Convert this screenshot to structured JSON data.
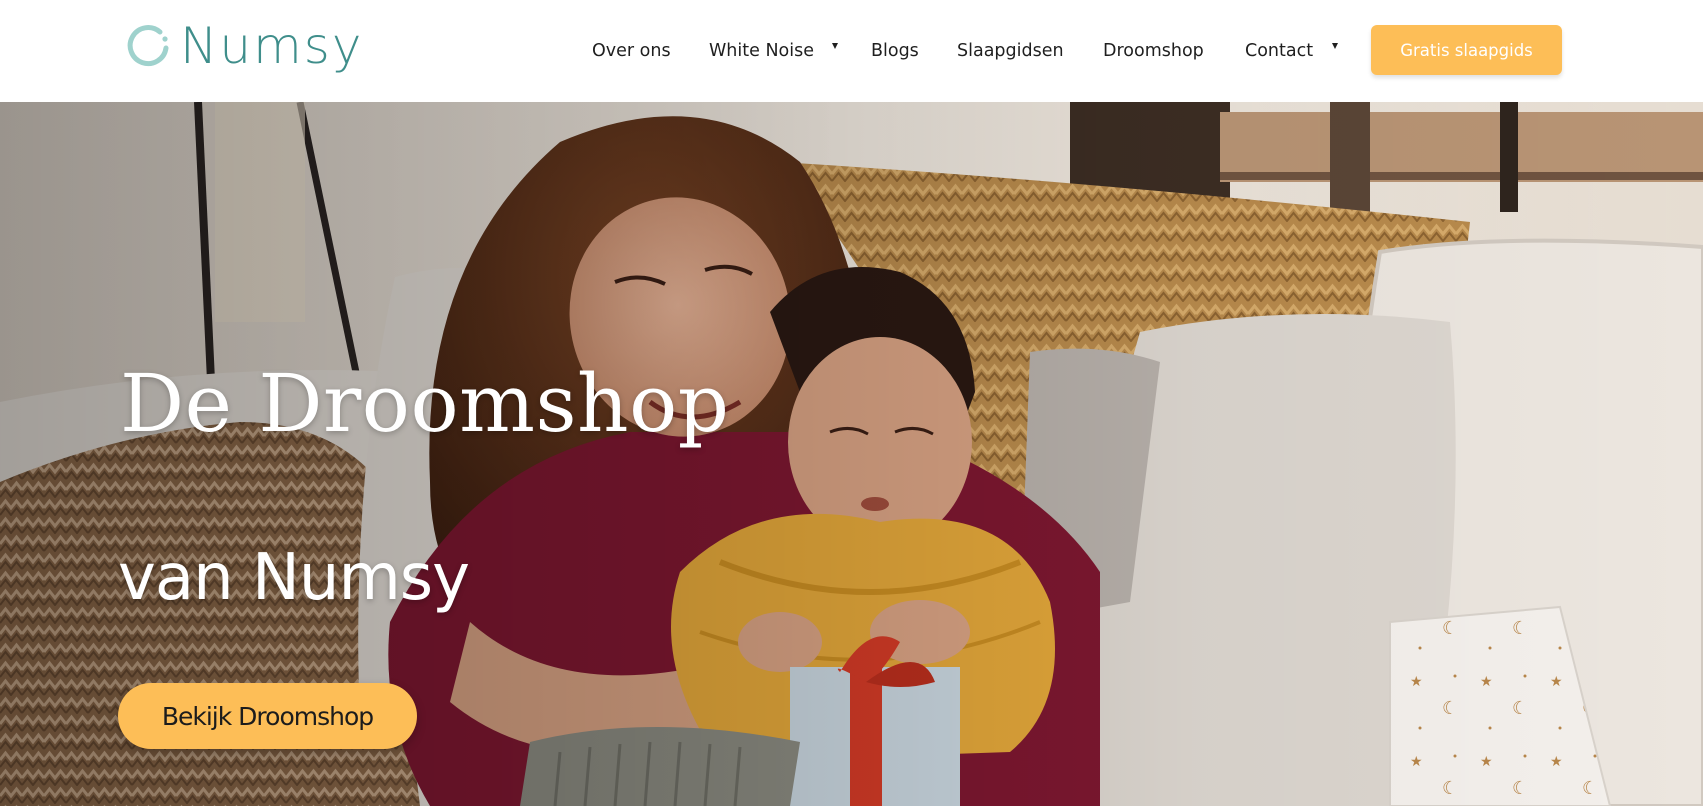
{
  "brand": {
    "name": "Numsy",
    "logo_icon": "crescent-moon-icon",
    "color": "#3f8e8b"
  },
  "nav": {
    "items": [
      {
        "label": "Over ons",
        "has_dropdown": false
      },
      {
        "label": "White Noise",
        "has_dropdown": true
      },
      {
        "label": "Blogs",
        "has_dropdown": false
      },
      {
        "label": "Slaapgidsen",
        "has_dropdown": false
      },
      {
        "label": "Droomshop",
        "has_dropdown": false
      },
      {
        "label": "Contact",
        "has_dropdown": true
      }
    ],
    "dropdown_icon": "caret-down-icon",
    "cta_label": "Gratis slaapgids"
  },
  "hero": {
    "title": "De Droomshop",
    "subtitle": "van Numsy",
    "button_label": "Bekijk Droomshop",
    "image_icon": "mother-child-gift-photo"
  },
  "colors": {
    "accent": "#fdbe57",
    "text_dark": "#1f1f1f",
    "white": "#ffffff"
  }
}
